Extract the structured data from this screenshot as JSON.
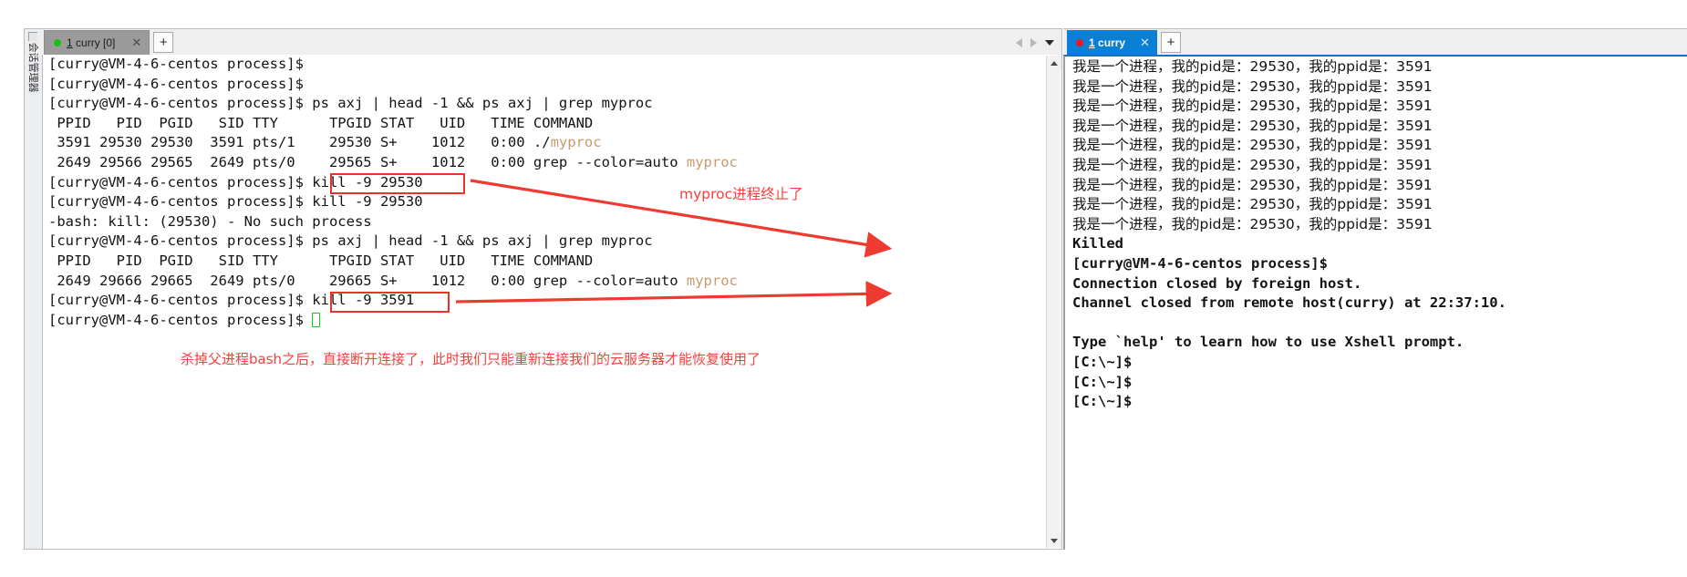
{
  "left_window": {
    "sidebar": {
      "label": "会话管理器",
      "grip_icon": "resize-grip-icon"
    },
    "tab": {
      "label_prefix": "1",
      "label_rest": " curry [0]",
      "status_dot_color": "#17c217",
      "close_icon": "close-icon"
    },
    "new_tab_label": "+",
    "nav": {
      "prev_icon": "arrow-left-icon",
      "next_icon": "arrow-right-icon",
      "menu_icon": "chevron-down-icon"
    },
    "scrollbar": {
      "up_icon": "scroll-up-icon",
      "down_icon": "scroll-down-icon"
    },
    "terminal_lines": [
      {
        "text": "[curry@VM-4-6-centos process]$"
      },
      {
        "text": "[curry@VM-4-6-centos process]$"
      },
      {
        "text": "[curry@VM-4-6-centos process]$ ps axj | head -1 && ps axj | grep myproc"
      },
      {
        "text": " PPID   PID  PGID   SID TTY      TPGID STAT   UID   TIME COMMAND"
      },
      {
        "pre": " 3591 29530 29530  3591 pts/1    29530 S+    1012   0:00 ./",
        "hl": "myproc",
        "post": ""
      },
      {
        "pre": " 2649 29566 29565  2649 pts/0    29565 S+    1012   0:00 grep --color=auto ",
        "hl": "myproc",
        "post": ""
      },
      {
        "text": "[curry@VM-4-6-centos process]$ kill -9 29530"
      },
      {
        "text": "[curry@VM-4-6-centos process]$ kill -9 29530"
      },
      {
        "text": "-bash: kill: (29530) - No such process"
      },
      {
        "text": "[curry@VM-4-6-centos process]$ ps axj | head -1 && ps axj | grep myproc"
      },
      {
        "text": " PPID   PID  PGID   SID TTY      TPGID STAT   UID   TIME COMMAND"
      },
      {
        "pre": " 2649 29666 29665  2649 pts/0    29665 S+    1012   0:00 grep --color=auto ",
        "hl": "myproc",
        "post": ""
      },
      {
        "text": "[curry@VM-4-6-centos process]$ kill -9 3591"
      },
      {
        "text": "[curry@VM-4-6-centos process]$ ",
        "cursor": true
      }
    ],
    "annotations": {
      "note_top": "myproc进程终止了",
      "note_bottom": "杀掉父进程bash之后，直接断开连接了，此时我们只能重新连接我们的云服务器才能恢复使用了",
      "box1_target": "kill -9 29530",
      "box2_target": "kill -9 3591",
      "color": "#f4403a"
    }
  },
  "right_window": {
    "tab": {
      "label_prefix": "1",
      "label_rest": " curry",
      "status_dot_color": "#e81b1b",
      "close_icon": "close-icon"
    },
    "new_tab_label": "+",
    "terminal_lines": [
      {
        "text": "我是一个进程，我的pid是：29530，我的ppid是：3591",
        "cjk": true
      },
      {
        "text": "我是一个进程，我的pid是：29530，我的ppid是：3591",
        "cjk": true
      },
      {
        "text": "我是一个进程，我的pid是：29530，我的ppid是：3591",
        "cjk": true
      },
      {
        "text": "我是一个进程，我的pid是：29530，我的ppid是：3591",
        "cjk": true
      },
      {
        "text": "我是一个进程，我的pid是：29530，我的ppid是：3591",
        "cjk": true
      },
      {
        "text": "我是一个进程，我的pid是：29530，我的ppid是：3591",
        "cjk": true
      },
      {
        "text": "我是一个进程，我的pid是：29530，我的ppid是：3591",
        "cjk": true
      },
      {
        "text": "我是一个进程，我的pid是：29530，我的ppid是：3591",
        "cjk": true
      },
      {
        "text": "我是一个进程，我的pid是：29530，我的ppid是：3591",
        "cjk": true
      },
      {
        "text": "Killed"
      },
      {
        "text": "[curry@VM-4-6-centos process]$"
      },
      {
        "text": "Connection closed by foreign host."
      },
      {
        "text": "Channel closed from remote host(curry) at 22:37:10."
      },
      {
        "text": ""
      },
      {
        "text": "Type `help' to learn how to use Xshell prompt."
      },
      {
        "text": "[C:\\~]$"
      },
      {
        "text": "[C:\\~]$"
      },
      {
        "text": "[C:\\~]$"
      }
    ]
  }
}
